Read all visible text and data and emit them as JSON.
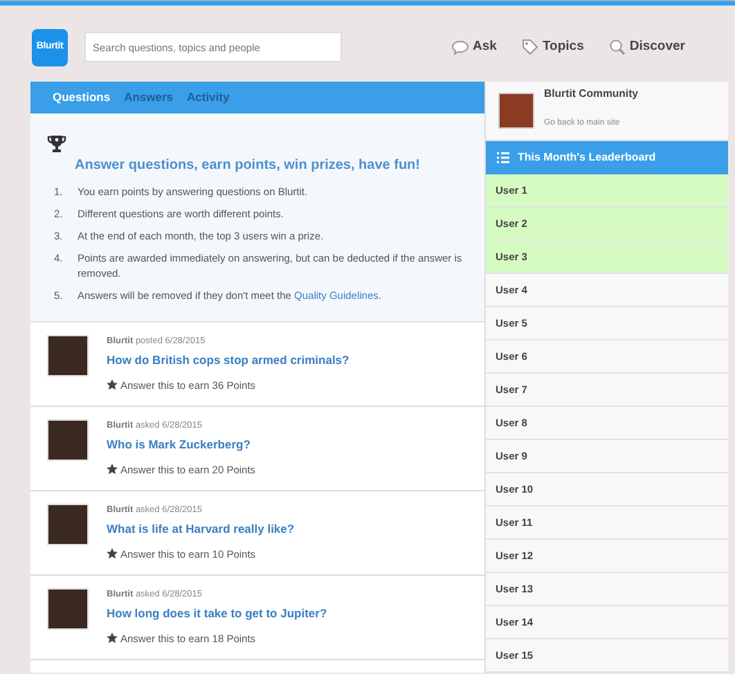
{
  "header": {
    "logo": "Blurtit",
    "search": {
      "placeholder": "Search questions, topics and people"
    },
    "nav": [
      {
        "label": "Ask",
        "kind": "ask"
      },
      {
        "label": "Topics",
        "kind": "topics"
      },
      {
        "label": "Discover",
        "kind": "discover"
      }
    ]
  },
  "tabs": [
    {
      "label": "Questions",
      "selected": true
    },
    {
      "label": "Answers",
      "selected": false
    },
    {
      "label": "Activity",
      "selected": false
    }
  ],
  "intro": {
    "title": "Answer questions, earn points, win prizes, have fun!",
    "items": [
      {
        "number": "1.",
        "text": "You earn points by answering questions on Blurtit."
      },
      {
        "number": "2.",
        "text": "Different questions are worth different points."
      },
      {
        "number": "3.",
        "text": "At the end of each month, the top 3 users win a prize."
      },
      {
        "number": "4.",
        "text": "Points are awarded immediately on answering, but can be deducted if the answer is removed."
      },
      {
        "number": "5.",
        "text": "Answers will be removed if they don't meet the",
        "link": "Quality Guidelines",
        "after": "."
      }
    ]
  },
  "questions": [
    {
      "author": "Blurtit",
      "action": "posted 6/28/2015",
      "title": "How do British cops stop armed criminals?",
      "reward": "Answer this to earn 36 Points"
    },
    {
      "author": "Blurtit",
      "action": "asked 6/28/2015",
      "title": "Who is Mark Zuckerberg?",
      "reward": "Answer this to earn 20 Points"
    },
    {
      "author": "Blurtit",
      "action": "asked 6/28/2015",
      "title": "What is life at Harvard really like?",
      "reward": "Answer this to earn 10 Points"
    },
    {
      "author": "Blurtit",
      "action": "asked 6/28/2015",
      "title": "How long does it take to get to Jupiter?",
      "reward": "Answer this to earn 18 Points"
    }
  ],
  "community": {
    "name": "Blurtit Community",
    "subtitle": "Go back to main site"
  },
  "leaderboard": {
    "title": "This Month's Leaderboard",
    "users": [
      {
        "name": "User 1",
        "highlighted": true
      },
      {
        "name": "User 2",
        "highlighted": true
      },
      {
        "name": "User 3",
        "highlighted": true
      },
      {
        "name": "User 4",
        "highlighted": false
      },
      {
        "name": "User 5",
        "highlighted": false
      },
      {
        "name": "User 6",
        "highlighted": false
      },
      {
        "name": "User 7",
        "highlighted": false
      },
      {
        "name": "User 8",
        "highlighted": false
      },
      {
        "name": "User 9",
        "highlighted": false
      },
      {
        "name": "User 10",
        "highlighted": false
      },
      {
        "name": "User 11",
        "highlighted": false
      },
      {
        "name": "User 12",
        "highlighted": false
      },
      {
        "name": "User 13",
        "highlighted": false
      },
      {
        "name": "User 14",
        "highlighted": false
      },
      {
        "name": "User 15",
        "highlighted": false
      }
    ]
  }
}
